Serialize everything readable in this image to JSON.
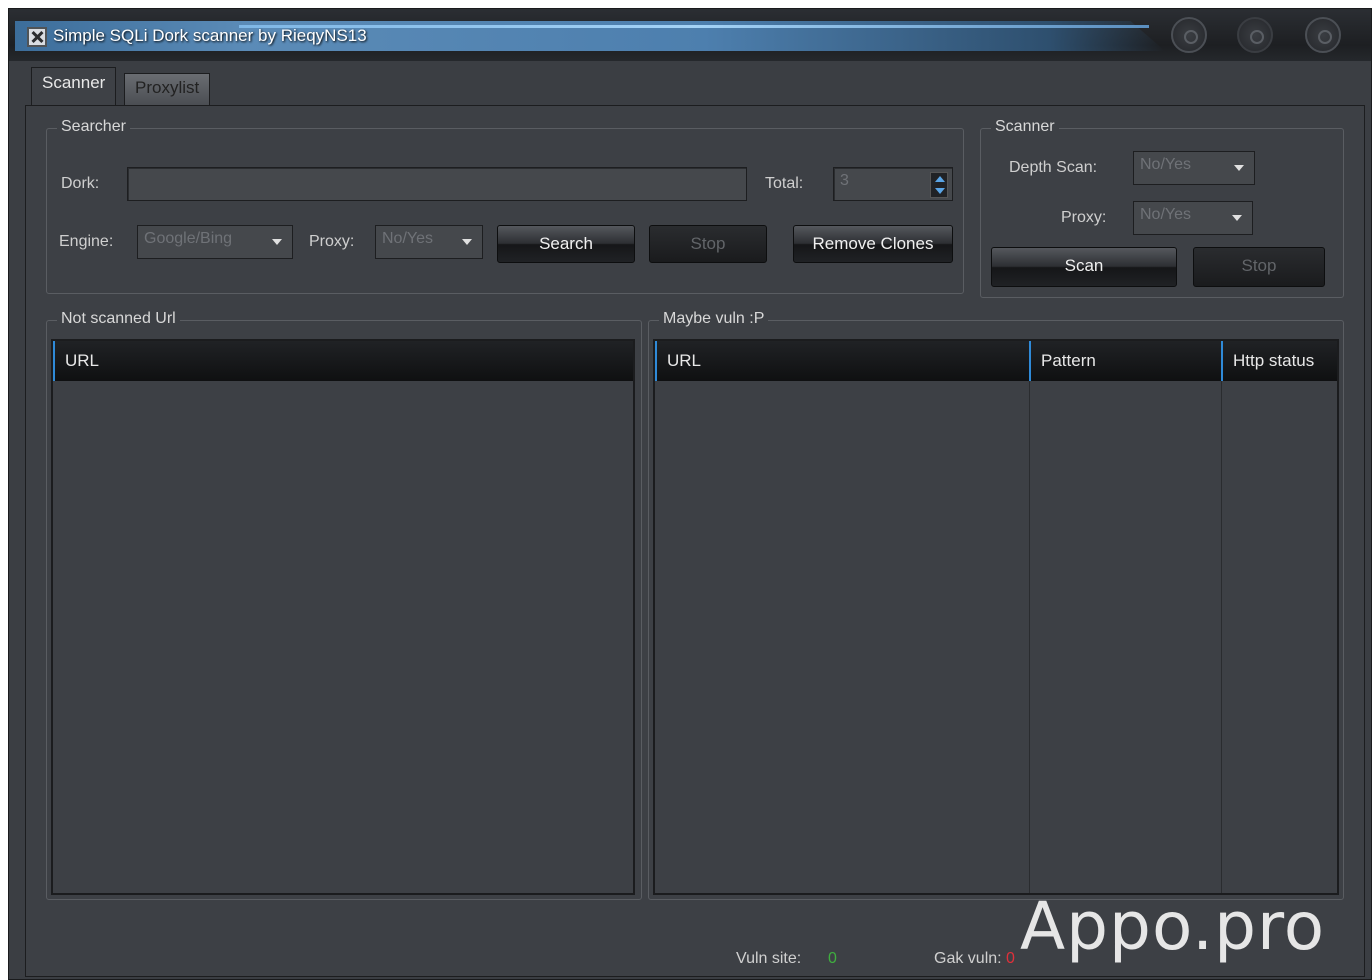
{
  "window": {
    "title": "Simple SQLi Dork scanner by RieqyNS13"
  },
  "tabs": [
    {
      "label": "Scanner",
      "active": true
    },
    {
      "label": "Proxylist",
      "active": false
    }
  ],
  "searcher": {
    "group_title": "Searcher",
    "dork_label": "Dork:",
    "dork_value": "",
    "total_label": "Total:",
    "total_value": "3",
    "engine_label": "Engine:",
    "engine_value": "Google/Bing",
    "proxy_label": "Proxy:",
    "proxy_value": "No/Yes",
    "search_button": "Search",
    "stop_button": "Stop",
    "remove_clones_button": "Remove Clones"
  },
  "scanner": {
    "group_title": "Scanner",
    "depth_label": "Depth Scan:",
    "depth_value": "No/Yes",
    "proxy_label": "Proxy:",
    "proxy_value": "No/Yes",
    "scan_button": "Scan",
    "stop_button": "Stop"
  },
  "not_scanned": {
    "group_title": "Not scanned Url",
    "columns": [
      "URL"
    ]
  },
  "maybe_vuln": {
    "group_title": "Maybe vuln :P",
    "columns": [
      "URL",
      "Pattern",
      "Http status"
    ]
  },
  "status": {
    "vuln_label": "Vuln site:",
    "vuln_value": "0",
    "gak_label": "Gak vuln:",
    "gak_value": "0"
  },
  "watermark": "Appo.pro",
  "colors": {
    "accent": "#2f8ad8",
    "vuln_value": "#3fae3f",
    "gak_value": "#e0303a"
  }
}
